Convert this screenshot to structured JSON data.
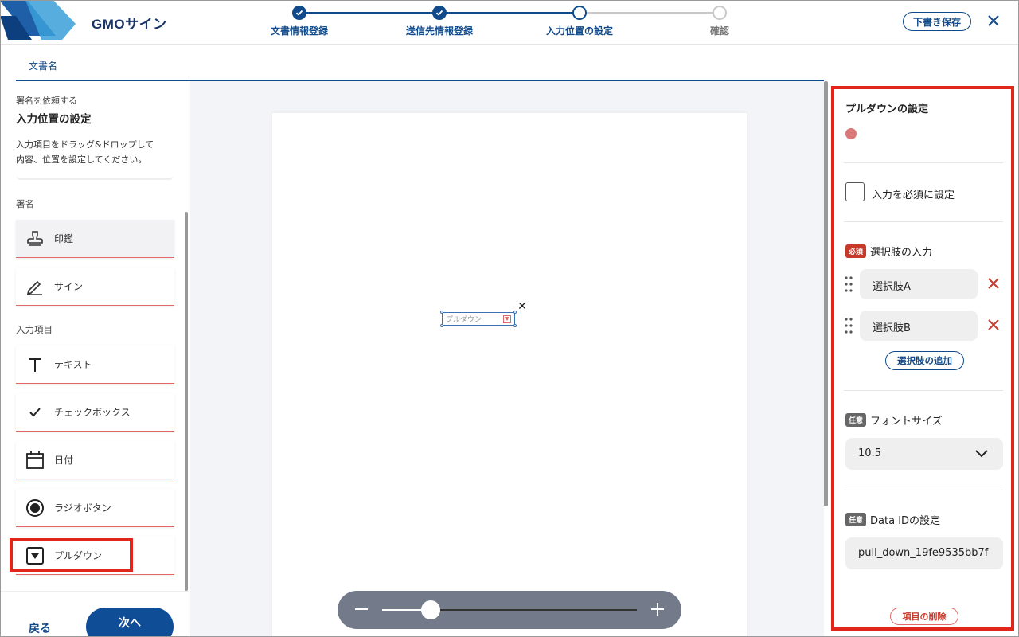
{
  "header": {
    "logo_text": "GMOサイン",
    "steps": [
      {
        "label": "文書情報登録",
        "state": "done"
      },
      {
        "label": "送信先情報登録",
        "state": "done"
      },
      {
        "label": "入力位置の設定",
        "state": "current"
      },
      {
        "label": "確認",
        "state": "todo"
      }
    ],
    "draft_save_label": "下書き保存",
    "close_icon": "close-icon",
    "accent_color": "#114a8a"
  },
  "doc_tab": {
    "label": "文書名"
  },
  "left_panel": {
    "subtitle": "署名を依頼する",
    "title": "入力位置の設定",
    "description_line1": "入力項目をドラッグ&ドロップして",
    "description_line2": "内容、位置を設定してください。",
    "signature_group_label": "署名",
    "signature_tools": [
      {
        "label": "印鑑",
        "icon": "stamp-icon"
      },
      {
        "label": "サイン",
        "icon": "pen-icon"
      }
    ],
    "input_group_label": "入力項目",
    "input_tools": [
      {
        "label": "テキスト",
        "icon": "text-icon"
      },
      {
        "label": "チェックボックス",
        "icon": "checkmark-icon"
      },
      {
        "label": "日付",
        "icon": "calendar-icon"
      },
      {
        "label": "ラジオボタン",
        "icon": "radio-icon"
      },
      {
        "label": "プルダウン",
        "icon": "dropdown-icon"
      }
    ],
    "back_label": "戻る",
    "next_label": "次へ"
  },
  "canvas": {
    "field_placeholder": "プルダウン",
    "delete_glyph": "✕",
    "zoom_level": 0.19
  },
  "right_panel": {
    "title": "プルダウンの設定",
    "field_color": "#d97878",
    "required_checkbox_label": "入力を必須に設定",
    "required_checked": false,
    "required_badge": "必須",
    "optional_badge": "任意",
    "options_label": "選択肢の入力",
    "options": [
      "選択肢A",
      "選択肢B"
    ],
    "add_option_label": "選択肢の追加",
    "font_size_label": "フォントサイズ",
    "font_size_value": "10.5",
    "data_id_label": "Data IDの設定",
    "data_id_value": "pull_down_19fe9535bb7f",
    "delete_item_label": "項目の削除"
  }
}
